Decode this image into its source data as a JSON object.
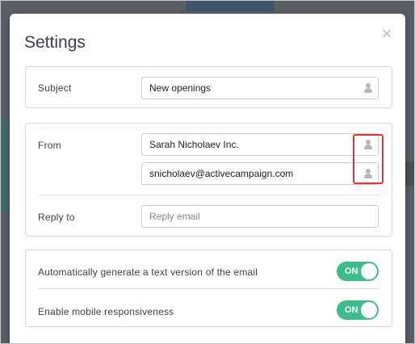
{
  "modal": {
    "title": "Settings",
    "close_symbol": "×"
  },
  "subject": {
    "label": "Subject",
    "value": "New openings",
    "icon": "person-icon"
  },
  "from": {
    "label": "From",
    "name_value": "Sarah Nicholaev Inc.",
    "email_value": "snicholaev@activecampaign.com",
    "icon": "person-icon"
  },
  "reply_to": {
    "label": "Reply to",
    "placeholder": "Reply email"
  },
  "toggles": [
    {
      "label": "Automatically generate a text version of the email",
      "state": "ON"
    },
    {
      "label": "Enable mobile responsiveness",
      "state": "ON"
    }
  ],
  "colors": {
    "toggle_on": "#3dbd8c",
    "highlight": "#e3342f"
  }
}
